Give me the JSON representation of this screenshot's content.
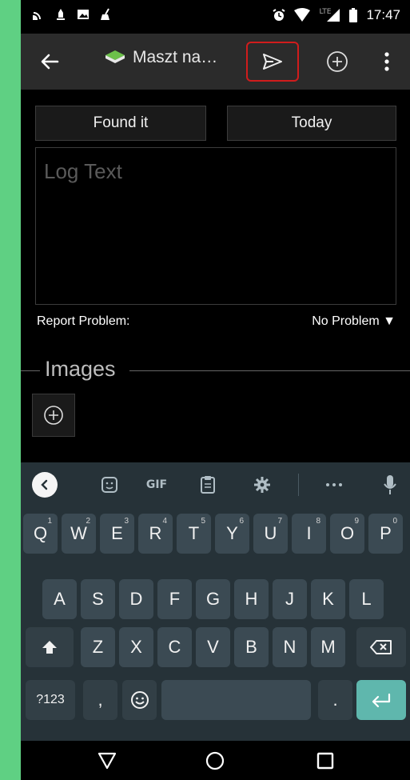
{
  "status_bar": {
    "left_icons": [
      "wifi-call-icon",
      "rocket-icon",
      "image-icon",
      "broom-icon"
    ],
    "right_icons": [
      "alarm-icon",
      "wifi-signal-icon",
      "cell-signal-icon",
      "battery-icon"
    ],
    "network": "LTE",
    "time": "17:47"
  },
  "toolbar": {
    "title": "Maszt na…",
    "back_icon": "arrow-left-icon",
    "cache_icon": "green-book-icon",
    "send_icon": "send-icon",
    "add_icon": "plus-circle-icon",
    "menu_icon": "more-vert-icon",
    "highlight_color": "#d01c1c"
  },
  "log": {
    "type_button": "Found it",
    "date_button": "Today",
    "text_placeholder": "Log Text",
    "report_label": "Report Problem:",
    "problem_value": "No Problem ▼"
  },
  "images": {
    "heading": "Images",
    "add_icon": "plus-circle-icon"
  },
  "keyboard": {
    "toolbar": [
      "back-icon",
      "sticker-icon",
      "GIF",
      "clipboard-icon",
      "gear-icon",
      "more-icon",
      "mic-icon"
    ],
    "row1": [
      {
        "key": "Q",
        "sup": "1"
      },
      {
        "key": "W",
        "sup": "2"
      },
      {
        "key": "E",
        "sup": "3"
      },
      {
        "key": "R",
        "sup": "4"
      },
      {
        "key": "T",
        "sup": "5"
      },
      {
        "key": "Y",
        "sup": "6"
      },
      {
        "key": "U",
        "sup": "7"
      },
      {
        "key": "I",
        "sup": "8"
      },
      {
        "key": "O",
        "sup": "9"
      },
      {
        "key": "P",
        "sup": "0"
      }
    ],
    "row2": [
      "A",
      "S",
      "D",
      "F",
      "G",
      "H",
      "J",
      "K",
      "L"
    ],
    "row3": [
      "Z",
      "X",
      "C",
      "V",
      "B",
      "N",
      "M"
    ],
    "row4": {
      "symbols": "?123",
      "comma": ",",
      "period": "."
    },
    "accent_color": "#5fb7ad"
  },
  "nav_bar": [
    "back-triangle-icon",
    "home-circle-icon",
    "recents-square-icon"
  ]
}
